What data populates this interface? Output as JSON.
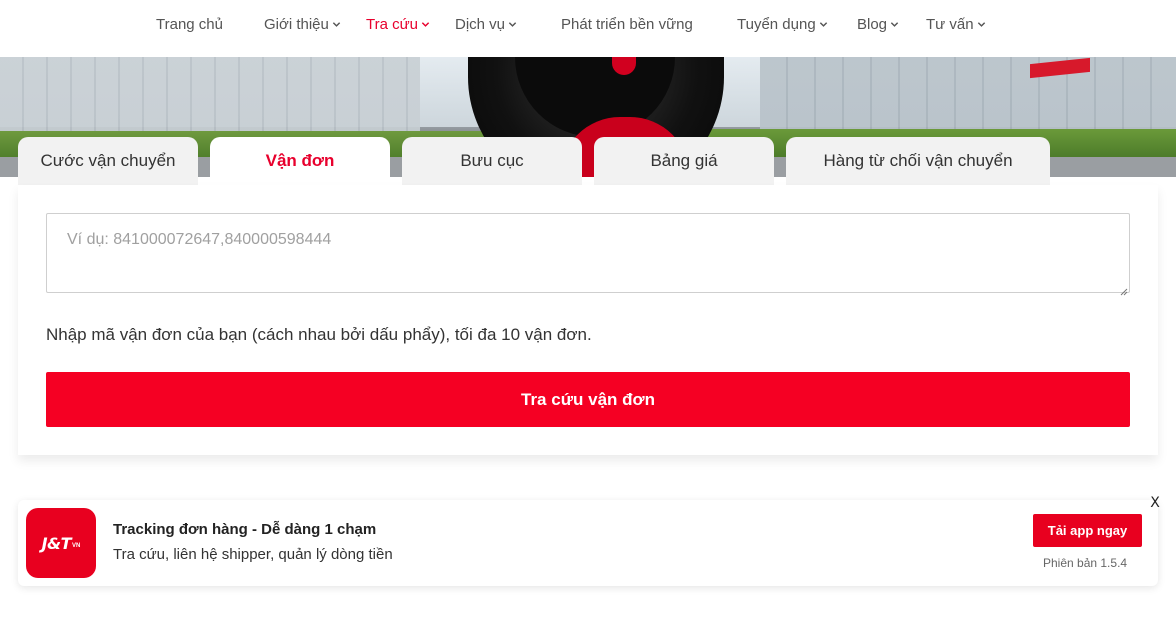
{
  "nav": {
    "items": [
      {
        "label": "Trang chủ",
        "dropdown": false,
        "active": false
      },
      {
        "label": "Giới thiệu",
        "dropdown": true,
        "active": false
      },
      {
        "label": "Tra cứu",
        "dropdown": true,
        "active": true
      },
      {
        "label": "Dịch vụ",
        "dropdown": true,
        "active": false
      },
      {
        "label": "Phát triển bền vững",
        "dropdown": false,
        "active": false
      },
      {
        "label": "Tuyển dụng",
        "dropdown": true,
        "active": false
      },
      {
        "label": "Blog",
        "dropdown": true,
        "active": false
      },
      {
        "label": "Tư vấn",
        "dropdown": true,
        "active": false
      }
    ]
  },
  "tabs": [
    {
      "label": "Cước vận chuyển",
      "active": false
    },
    {
      "label": "Vận đơn",
      "active": true
    },
    {
      "label": "Bưu cục",
      "active": false
    },
    {
      "label": "Bảng giá",
      "active": false
    },
    {
      "label": "Hàng từ chối vận chuyển",
      "active": false
    }
  ],
  "tracking": {
    "input_value": "",
    "input_placeholder": "Ví dụ: 841000072647,840000598444",
    "helper_text": "Nhập mã vận đơn của bạn (cách nhau bởi dấu phẩy), tối đa 10 vận đơn.",
    "submit_label": "Tra cứu vận đơn"
  },
  "app_banner": {
    "logo_text": "J&T",
    "logo_suffix": "VN",
    "title": "Tracking đơn hàng - Dễ dàng 1 chạm",
    "description": "Tra cứu, liên hệ shipper, quản lý dòng tiền",
    "download_label": "Tải app ngay",
    "version": "Phiên bản 1.5.4",
    "close_label": "X"
  },
  "colors": {
    "brand_red": "#e8002d",
    "button_red": "#f50023",
    "tab_inactive": "#f2f2f2"
  }
}
